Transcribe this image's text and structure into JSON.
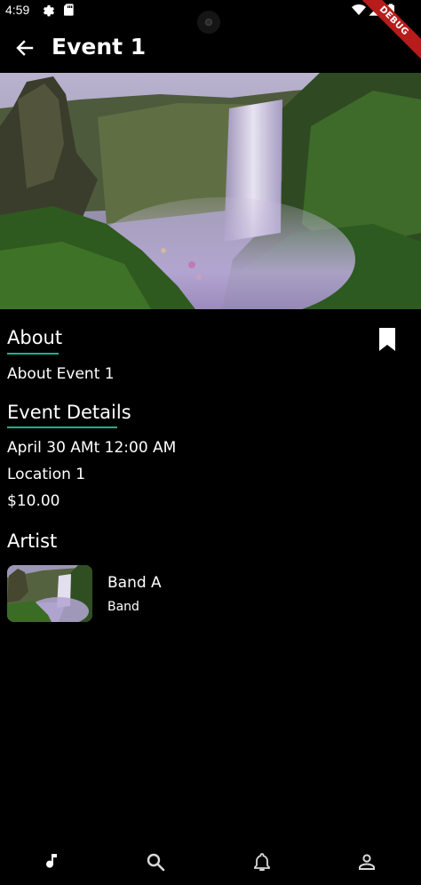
{
  "status_bar": {
    "time": "4:59",
    "debug_label": "DEBUG"
  },
  "app_bar": {
    "title": "Event 1"
  },
  "about": {
    "heading": "About",
    "text": "About Event 1"
  },
  "event_details": {
    "heading": "Event Details",
    "datetime": "April 30 AMt 12:00 AM",
    "location": "Location 1",
    "price": "$10.00"
  },
  "artist": {
    "heading": "Artist",
    "name": "Band A",
    "type": "Band"
  },
  "colors": {
    "background": "#000000",
    "accent_underline": "#1db38a",
    "debug_banner": "#b71c1c"
  },
  "bottom_nav": {
    "items": [
      {
        "icon": "music-note-icon",
        "active": true
      },
      {
        "icon": "search-icon",
        "active": false
      },
      {
        "icon": "bell-icon",
        "active": false
      },
      {
        "icon": "person-icon",
        "active": false
      }
    ]
  }
}
